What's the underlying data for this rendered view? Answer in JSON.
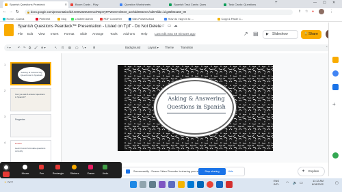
{
  "browser": {
    "tabs": [
      {
        "label": "Spanish Questions Peardeck",
        "active": true
      },
      {
        "label": "Boom Cards - Play",
        "active": false
      },
      {
        "label": "Question Worksheets",
        "active": false
      },
      {
        "label": "Spanish Task Cards: Ques",
        "active": false
      },
      {
        "label": "Task Cards: Questions",
        "active": false
      }
    ],
    "url": "docs.google.com/presentation/d/1GH8w8z2UEOwd7Dps7yFPWvMAmlOxO_a2chdd0S6eOA/edit#slide=id.g35f351150_00",
    "bookmarks": [
      "Home - Canva",
      "Pinterest",
      "blog",
      "Linktree Admin",
      "PDF Converter",
      "Kids Powerschool",
      "How do I sign in to ...",
      "Copy & Paste C..."
    ]
  },
  "slides_app": {
    "title": "Spanish Questions Peardeck™ Presentation - Listed on TpT - Do Not Delete",
    "menu": [
      "File",
      "Edit",
      "View",
      "Insert",
      "Format",
      "Slide",
      "Arrange",
      "Tools",
      "Add-ons",
      "Help"
    ],
    "last_edit": "Last edit was 49 minutes ago",
    "slideshow_label": "Slideshow",
    "share_label": "Share",
    "toolbar": {
      "background": "Background",
      "layout": "Layout ▾",
      "theme": "Theme",
      "transition": "Transition"
    },
    "explore_label": "Explore"
  },
  "filmstrip": [
    {
      "num": "1",
      "text": "Asking & Answering Questions in Spanish"
    },
    {
      "num": "2",
      "text": "Can you ask & answer questions in Spanish?"
    },
    {
      "num": "3",
      "text": "Preguntas"
    },
    {
      "num": "4",
      "text": "Prueba"
    },
    {
      "num": "5",
      "text": "Learn how to formulate questions correctly"
    }
  ],
  "slide": {
    "title_line1": "Asking & Answering",
    "title_line2": "Questions in Spanish"
  },
  "screencast": {
    "tools": [
      "Mouse",
      "Pen",
      "Rectangle",
      "Stickers",
      "Eraser",
      "Undo"
    ],
    "notice": "Screencastify - Screen Video Recorder is sharing your screen.",
    "stop_label": "Stop sharing",
    "hide_label": "Hide"
  },
  "taskbar": {
    "weather": "74°F",
    "lang": "ENG",
    "locale": "INTL",
    "time": "11:12 AM",
    "date": "8/18/2022"
  },
  "colors": {
    "accent": "#f9ab00",
    "stop": "#1a73e8"
  }
}
